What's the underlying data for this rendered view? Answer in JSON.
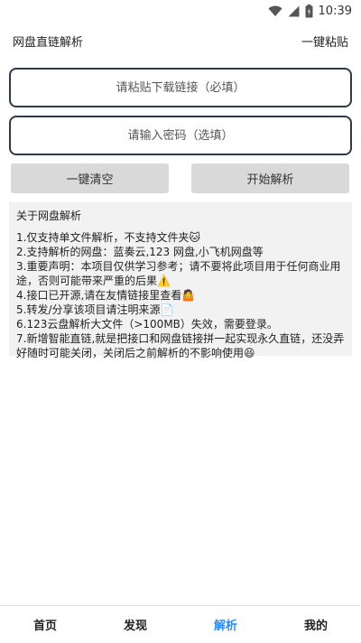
{
  "status_bar": {
    "time": "10:39",
    "icons": [
      "wifi-icon",
      "signal-icon",
      "battery-icon"
    ]
  },
  "header": {
    "title": "网盘直链解析",
    "paste_button": "一键粘贴"
  },
  "inputs": {
    "link_placeholder": "请粘贴下载链接（必填）",
    "password_placeholder": "请输入密码（选填）"
  },
  "buttons": {
    "clear": "一键清空",
    "parse": "开始解析"
  },
  "info": {
    "title": "关于网盘解析",
    "lines": [
      "1.仅支持单文件解析，不支持文件夹🐱",
      "2.支持解析的网盘：蓝奏云,123 网盘,小飞机网盘等",
      "3.重要声明：本项目仅供学习参考；请不要将此项目用于任何商业用途，否则可能带来严重的后果⚠️",
      "4.接口已开源,请在友情链接里查看🤷",
      "5.转发/分享该项目请注明来源📄",
      "6.123云盘解析大文件（>100MB）失效，需要登录。",
      "7.新增智能直链,就是把接口和网盘链接拼一起实现永久直链，还没弄好随时可能关闭，关闭后之前解析的不影响使用😆"
    ]
  },
  "tabs": [
    {
      "label": "首页"
    },
    {
      "label": "发现"
    },
    {
      "label": "解析",
      "active": true
    },
    {
      "label": "我的"
    }
  ],
  "colors": {
    "accent": "#2d8cf0",
    "border": "#2f3a48",
    "button_bg": "#d9d9d9",
    "info_bg": "#f2f2f2"
  }
}
